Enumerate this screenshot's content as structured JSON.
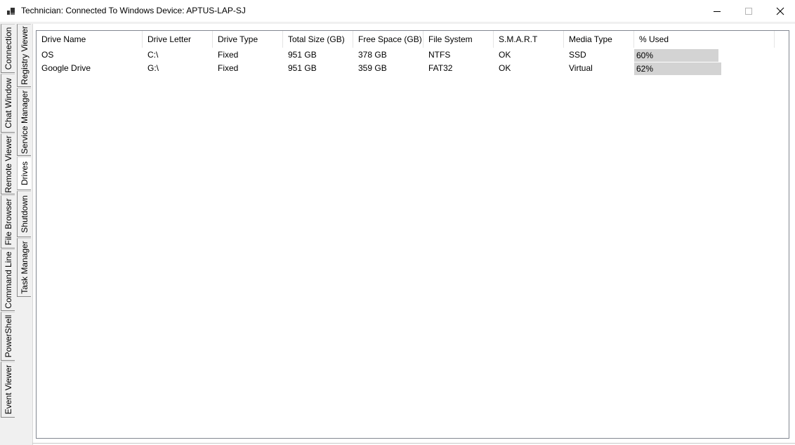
{
  "window": {
    "title": "Technician: Connected To Windows Device: APTUS-LAP-SJ",
    "app_icon": "app-icon",
    "controls": [
      "minimize-icon",
      "maximize-icon",
      "close-icon"
    ]
  },
  "tabs_outer": [
    {
      "label": "Connection"
    },
    {
      "label": "Chat Window"
    },
    {
      "label": "Remote Viewer"
    },
    {
      "label": "File Browser"
    },
    {
      "label": "Command Line"
    },
    {
      "label": "PowerShell"
    },
    {
      "label": "Event Viewer"
    }
  ],
  "tabs_inner": [
    {
      "label": "Registry Viewer"
    },
    {
      "label": "Service Manager"
    },
    {
      "label": "Drives",
      "selected": true
    },
    {
      "label": "Shutdown"
    },
    {
      "label": "Task Manager"
    }
  ],
  "drives": {
    "columns": [
      "Drive Name",
      "Drive Letter",
      "Drive Type",
      "Total Size (GB)",
      "Free Space (GB)",
      "File System",
      "S.M.A.R.T",
      "Media Type",
      "% Used"
    ],
    "rows": [
      {
        "name": "OS",
        "letter": "C:\\",
        "type": "Fixed",
        "total": "951 GB",
        "free": "378 GB",
        "fs": "NTFS",
        "smart": "OK",
        "media": "SSD",
        "used": "60%",
        "used_fraction": 0.6
      },
      {
        "name": "Google Drive",
        "letter": "G:\\",
        "type": "Fixed",
        "total": "951 GB",
        "free": "359 GB",
        "fs": "FAT32",
        "smart": "OK",
        "media": "Virtual",
        "used": "62%",
        "used_fraction": 0.62
      }
    ]
  },
  "colors": {
    "usage_bar": "#d3d3d3",
    "window_bg": "#f0f0f0",
    "content_bg": "#ffffff"
  }
}
